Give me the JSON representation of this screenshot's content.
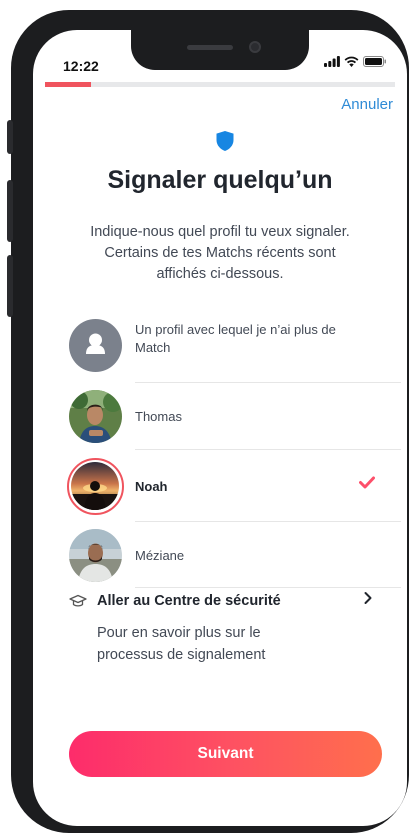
{
  "status_bar": {
    "time": "12:22"
  },
  "progress": {
    "value_fraction": 0.13,
    "color": "#f0545e"
  },
  "header": {
    "cancel_label": "Annuler",
    "shield_color": "#1786e2"
  },
  "title": "Signaler quelqu’un",
  "description": "Indique-nous quel profil tu veux signaler. Certains de tes Matchs récents sont affichés ci-dessous.",
  "profiles": [
    {
      "label": "Un profil avec lequel je n’ai plus de Match",
      "avatar_icon": "person-icon",
      "selected": false
    },
    {
      "label": "Thomas",
      "avatar_icon": "photo-avatar",
      "selected": false
    },
    {
      "label": "Noah",
      "avatar_icon": "photo-avatar",
      "selected": true
    },
    {
      "label": "Méziane",
      "avatar_icon": "photo-avatar",
      "selected": false
    }
  ],
  "safety_center": {
    "icon": "graduation-cap-icon",
    "title": "Aller au Centre de sécurité",
    "subtitle": "Pour en savoir plus sur le processus de signalement"
  },
  "cta": {
    "label": "Suivant"
  },
  "accent_color": "#fd4f6a"
}
